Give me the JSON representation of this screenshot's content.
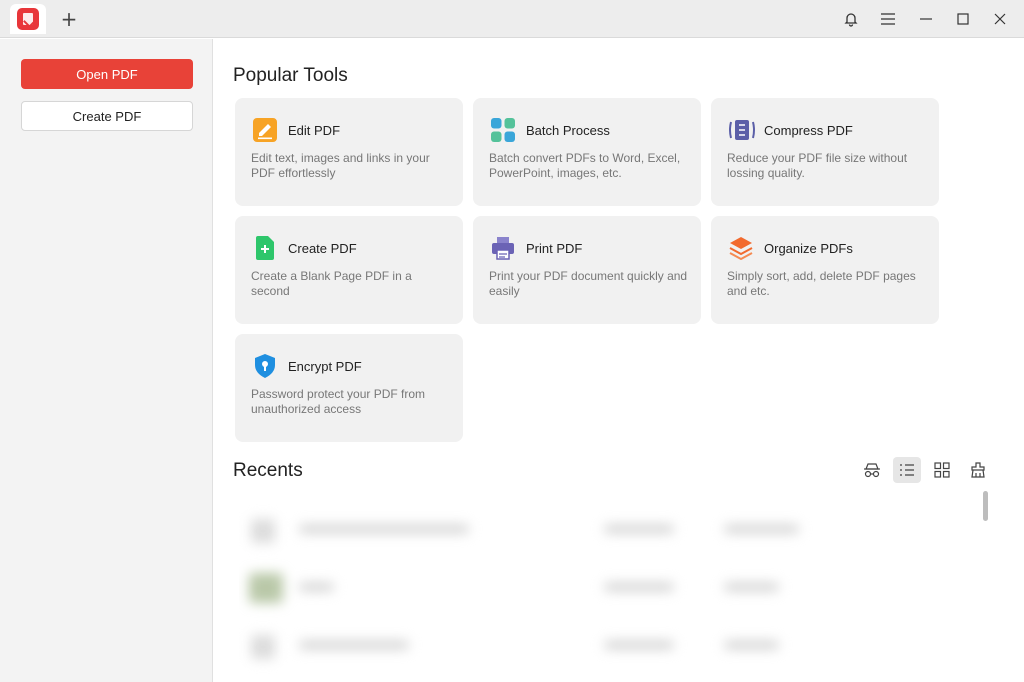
{
  "titlebar": {
    "app_icon": "pdf-app-logo",
    "new_tab_icon": "plus-icon",
    "controls": [
      "bell-icon",
      "menu-icon",
      "minimize-icon",
      "maximize-icon",
      "close-icon"
    ]
  },
  "sidebar": {
    "open_label": "Open PDF",
    "create_label": "Create PDF"
  },
  "main": {
    "popular_title": "Popular Tools",
    "tools": [
      {
        "title": "Edit PDF",
        "desc": "Edit text, images and links in your PDF effortlessly",
        "icon": "edit-icon",
        "color": "#f7a325"
      },
      {
        "title": "Batch Process",
        "desc": "Batch convert PDFs to Word, Excel, PowerPoint, images, etc.",
        "icon": "grid-icon",
        "color": "#3aa6d9"
      },
      {
        "title": "Compress PDF",
        "desc": "Reduce your PDF file size without lossing quality.",
        "icon": "compress-icon",
        "color": "#5b5fa8"
      },
      {
        "title": "Create PDF",
        "desc": "Create a Blank Page PDF in a second",
        "icon": "add-doc-icon",
        "color": "#2ec66b"
      },
      {
        "title": "Print PDF",
        "desc": "Print your PDF document quickly and easily",
        "icon": "printer-icon",
        "color": "#6b63b5"
      },
      {
        "title": "Organize PDFs",
        "desc": "Simply sort, add, delete PDF pages and etc.",
        "icon": "layers-icon",
        "color": "#f26a2e"
      },
      {
        "title": "Encrypt PDF",
        "desc": "Password protect your PDF from unauthorized access",
        "icon": "shield-icon",
        "color": "#1f8fe0"
      }
    ],
    "recents_title": "Recents",
    "view_icons": [
      "incognito-icon",
      "list-view-icon",
      "grid-view-icon",
      "clear-icon"
    ]
  }
}
